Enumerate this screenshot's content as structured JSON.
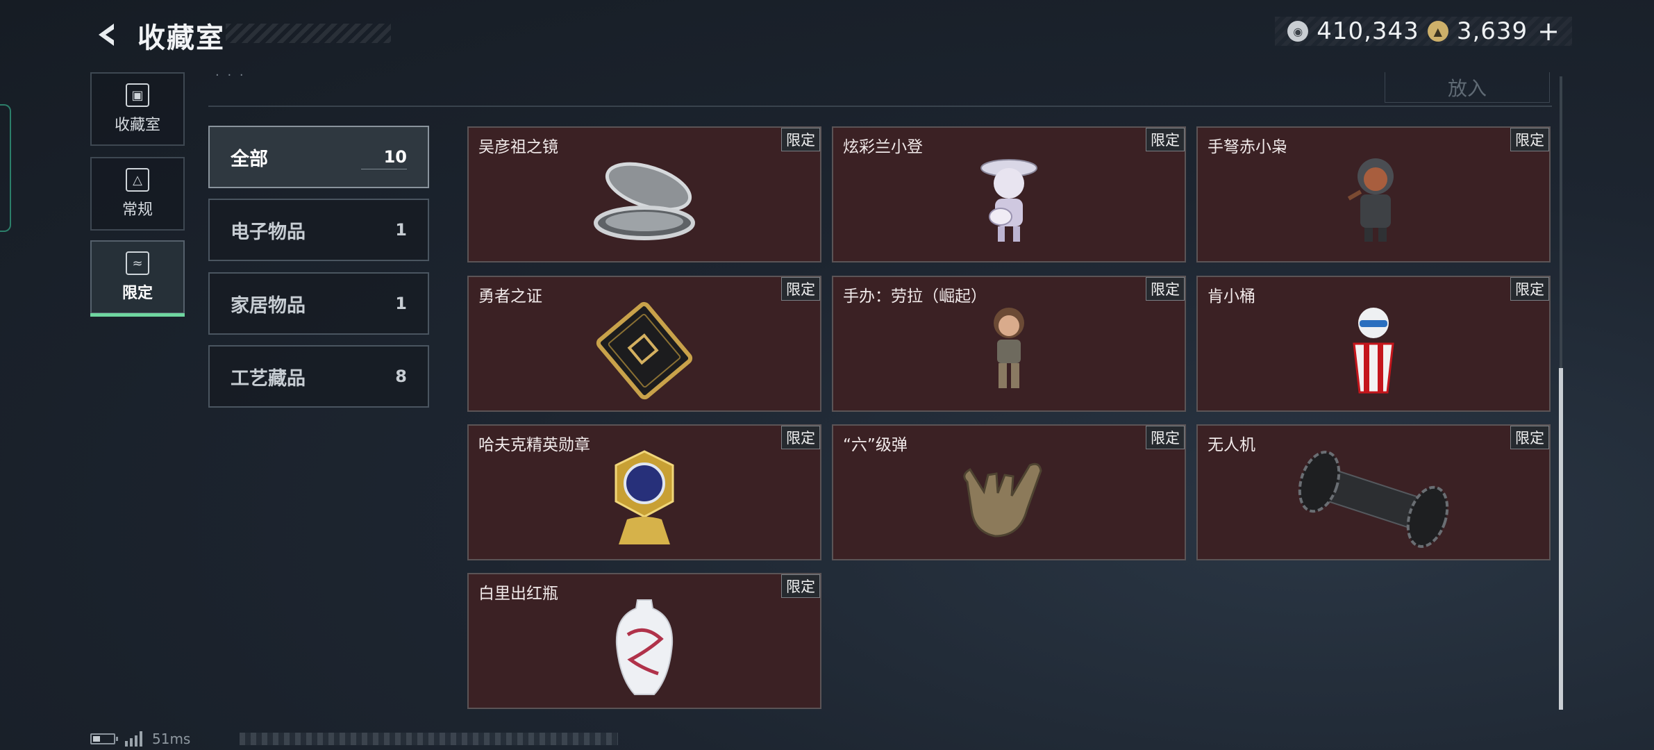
{
  "header": {
    "title": "收藏室",
    "currency": [
      {
        "icon": "silver-coin-icon",
        "value": "410,343"
      },
      {
        "icon": "gold-coin-icon",
        "value": "3,639"
      }
    ],
    "add_symbol": "+"
  },
  "top_residual": {
    "button_label": "放入"
  },
  "nav": [
    {
      "label": "收藏室",
      "icon": "collection-room-icon"
    },
    {
      "label": "常规",
      "icon": "regular-icon"
    },
    {
      "label": "限定",
      "icon": "limited-icon",
      "active": true
    }
  ],
  "categories": [
    {
      "name": "全部",
      "count": "10",
      "active": true
    },
    {
      "name": "电子物品",
      "count": "1"
    },
    {
      "name": "家居物品",
      "count": "1"
    },
    {
      "name": "工艺藏品",
      "count": "8"
    }
  ],
  "items": [
    {
      "name": "吴彦祖之镜",
      "tag": "限定",
      "icon": "mirror-compact-icon"
    },
    {
      "name": "炫彩兰小登",
      "tag": "限定",
      "icon": "guitar-figure-icon"
    },
    {
      "name": "手弩赤小枭",
      "tag": "限定",
      "icon": "hooded-figure-icon"
    },
    {
      "name": "勇者之证",
      "tag": "限定",
      "icon": "card-badge-icon"
    },
    {
      "name": "手办：劳拉（崛起）",
      "tag": "限定",
      "icon": "lara-figure-icon"
    },
    {
      "name": "肯小桶",
      "tag": "限定",
      "icon": "bucket-figure-icon"
    },
    {
      "name": "哈夫克精英勋章",
      "tag": "限定",
      "icon": "medal-icon"
    },
    {
      "name": "“六”级弹",
      "tag": "限定",
      "icon": "hand-gesture-icon"
    },
    {
      "name": "无人机",
      "tag": "限定",
      "icon": "drone-part-icon"
    },
    {
      "name": "白里出红瓶",
      "tag": "限定",
      "icon": "porcelain-vase-icon"
    }
  ],
  "status": {
    "ping": "51ms"
  },
  "colors": {
    "card_bg": "#3b2124",
    "accent": "#6fd6a0",
    "panel_bg": "#1d2530"
  }
}
